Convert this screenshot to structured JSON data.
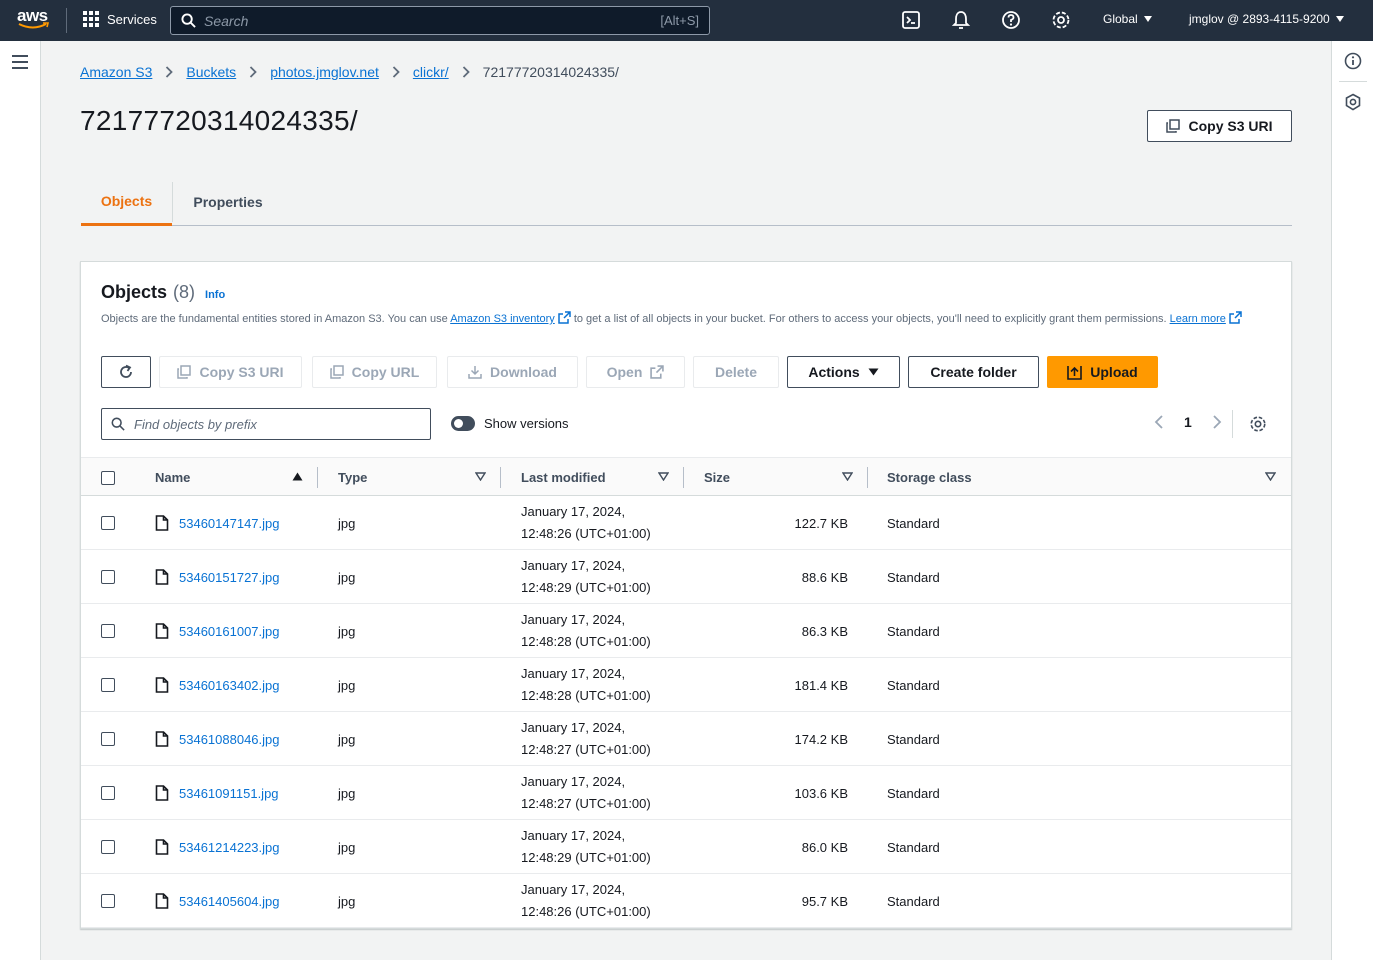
{
  "nav": {
    "logo_text": "aws",
    "services_label": "Services",
    "search_placeholder": "Search",
    "search_shortcut": "[Alt+S]",
    "region": "Global",
    "account": "jmglov @ 2893-4115-9200"
  },
  "breadcrumb": {
    "items": [
      "Amazon S3",
      "Buckets",
      "photos.jmglov.net",
      "clickr/"
    ],
    "current": "72177720314024335/"
  },
  "page": {
    "title": "72177720314024335/",
    "copy_s3_uri_label": "Copy S3 URI"
  },
  "tabs": [
    {
      "label": "Objects",
      "active": true
    },
    {
      "label": "Properties",
      "active": false
    }
  ],
  "objects_panel": {
    "title": "Objects",
    "count": "(8)",
    "info_label": "Info",
    "description_part1": "Objects are the fundamental entities stored in Amazon S3. You can use",
    "inventory_link": "Amazon S3 inventory",
    "description_part2": "to get a list of all objects in your bucket. For others to access your objects, you'll need to explicitly grant them permissions.",
    "learn_more": "Learn more",
    "toolbar": {
      "copy_s3_uri": "Copy S3 URI",
      "copy_url": "Copy URL",
      "download": "Download",
      "open": "Open",
      "delete": "Delete",
      "actions": "Actions",
      "create_folder": "Create folder",
      "upload": "Upload"
    },
    "filter_placeholder": "Find objects by prefix",
    "show_versions_label": "Show versions",
    "page_number": "1",
    "columns": [
      "Name",
      "Type",
      "Last modified",
      "Size",
      "Storage class"
    ],
    "rows": [
      {
        "name": "53460147147.jpg",
        "type": "jpg",
        "date": "January 17, 2024,",
        "time": "12:48:26 (UTC+01:00)",
        "size": "122.7 KB",
        "storage": "Standard"
      },
      {
        "name": "53460151727.jpg",
        "type": "jpg",
        "date": "January 17, 2024,",
        "time": "12:48:29 (UTC+01:00)",
        "size": "88.6 KB",
        "storage": "Standard"
      },
      {
        "name": "53460161007.jpg",
        "type": "jpg",
        "date": "January 17, 2024,",
        "time": "12:48:28 (UTC+01:00)",
        "size": "86.3 KB",
        "storage": "Standard"
      },
      {
        "name": "53460163402.jpg",
        "type": "jpg",
        "date": "January 17, 2024,",
        "time": "12:48:28 (UTC+01:00)",
        "size": "181.4 KB",
        "storage": "Standard"
      },
      {
        "name": "53461088046.jpg",
        "type": "jpg",
        "date": "January 17, 2024,",
        "time": "12:48:27 (UTC+01:00)",
        "size": "174.2 KB",
        "storage": "Standard"
      },
      {
        "name": "53461091151.jpg",
        "type": "jpg",
        "date": "January 17, 2024,",
        "time": "12:48:27 (UTC+01:00)",
        "size": "103.6 KB",
        "storage": "Standard"
      },
      {
        "name": "53461214223.jpg",
        "type": "jpg",
        "date": "January 17, 2024,",
        "time": "12:48:29 (UTC+01:00)",
        "size": "86.0 KB",
        "storage": "Standard"
      },
      {
        "name": "53461405604.jpg",
        "type": "jpg",
        "date": "January 17, 2024,",
        "time": "12:48:26 (UTC+01:00)",
        "size": "95.7 KB",
        "storage": "Standard"
      }
    ]
  },
  "colors": {
    "nav_bg": "#232f3e",
    "link": "#0972d3",
    "accent_orange": "#ec7211",
    "primary_button": "#ff9900"
  }
}
